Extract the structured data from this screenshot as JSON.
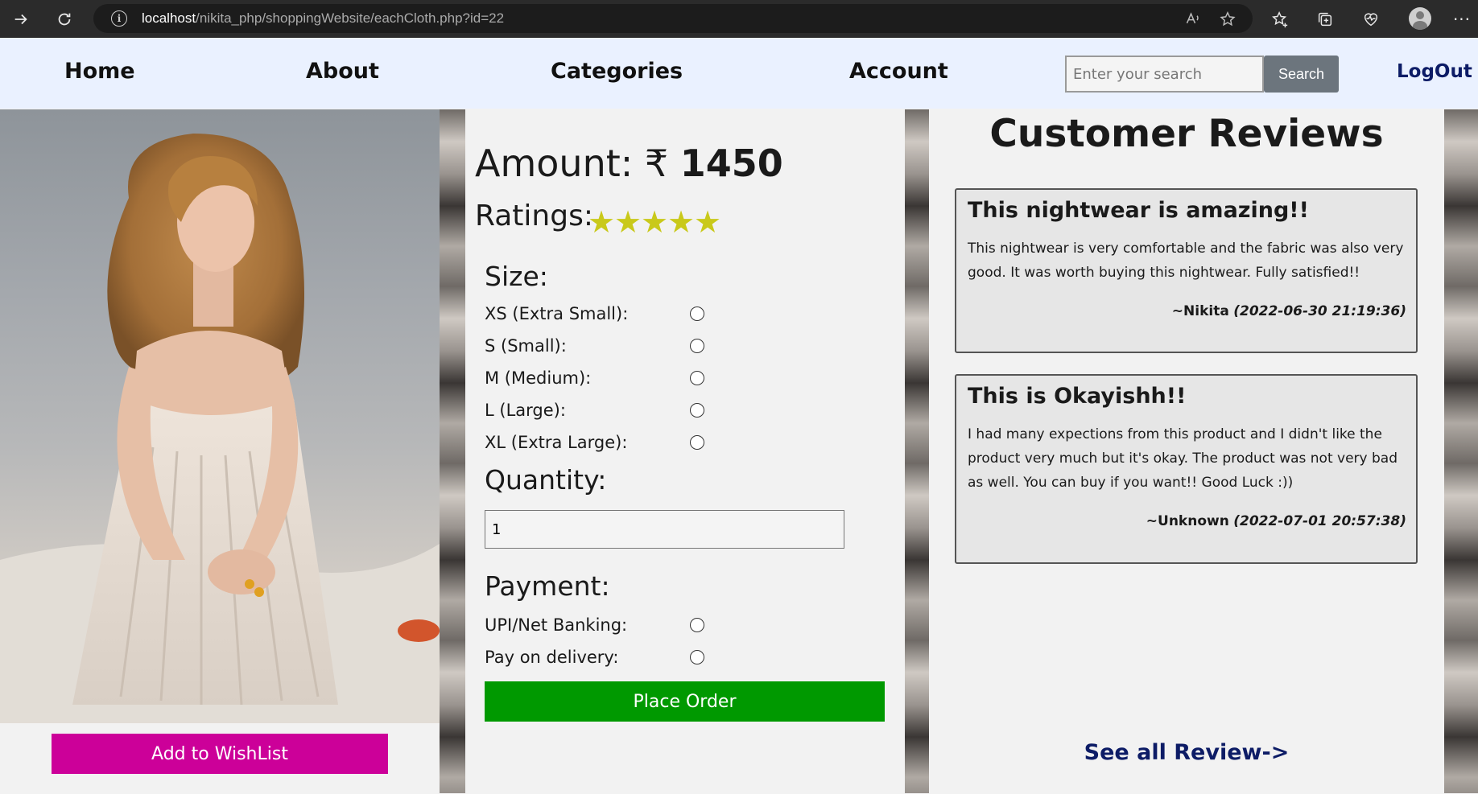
{
  "browser": {
    "url_host": "localhost",
    "url_path": "/nikita_php/shoppingWebsite/eachCloth.php?id=22"
  },
  "nav": {
    "home": "Home",
    "about": "About",
    "categories": "Categories",
    "account": "Account",
    "search_placeholder": "Enter your search",
    "search_button": "Search",
    "logout": "LogOut"
  },
  "product": {
    "amount_label": "Amount: ₹",
    "amount_value": "1450",
    "ratings_label": "Ratings:",
    "rating_stars": 5,
    "star_color": "#c9c91a",
    "size_title": "Size:",
    "sizes": [
      "XS (Extra Small):",
      "S (Small):",
      "M (Medium):",
      "L (Large):",
      "XL (Extra Large):"
    ],
    "quantity_title": "Quantity:",
    "quantity_value": "1",
    "payment_title": "Payment:",
    "payments": [
      "UPI/Net Banking:",
      "Pay on delivery:"
    ],
    "place_order": "Place Order",
    "wishlist": "Add to WishList"
  },
  "reviews": {
    "title": "Customer Reviews",
    "items": [
      {
        "title": "This nightwear is amazing!!",
        "body": "This nightwear is very comfortable and the fabric was also very good. It was worth buying this nightwear. Fully satisfied!!",
        "author": "~Nikita",
        "date": "(2022-06-30 21:19:36)"
      },
      {
        "title": "This is Okayishh!!",
        "body": "I had many expections from this product and I didn't like the product very much but it's okay. The product was not very bad as well. You can buy if you want!! Good Luck :))",
        "author": "~Unknown",
        "date": "(2022-07-01 20:57:38)"
      }
    ],
    "see_all": "See all Review->"
  },
  "colors": {
    "nav_bg": "#eaf1ff",
    "wishlist_bg": "#cc0099",
    "order_bg": "#009900",
    "search_bg": "#6c757d",
    "link_navy": "#0d1c66"
  }
}
